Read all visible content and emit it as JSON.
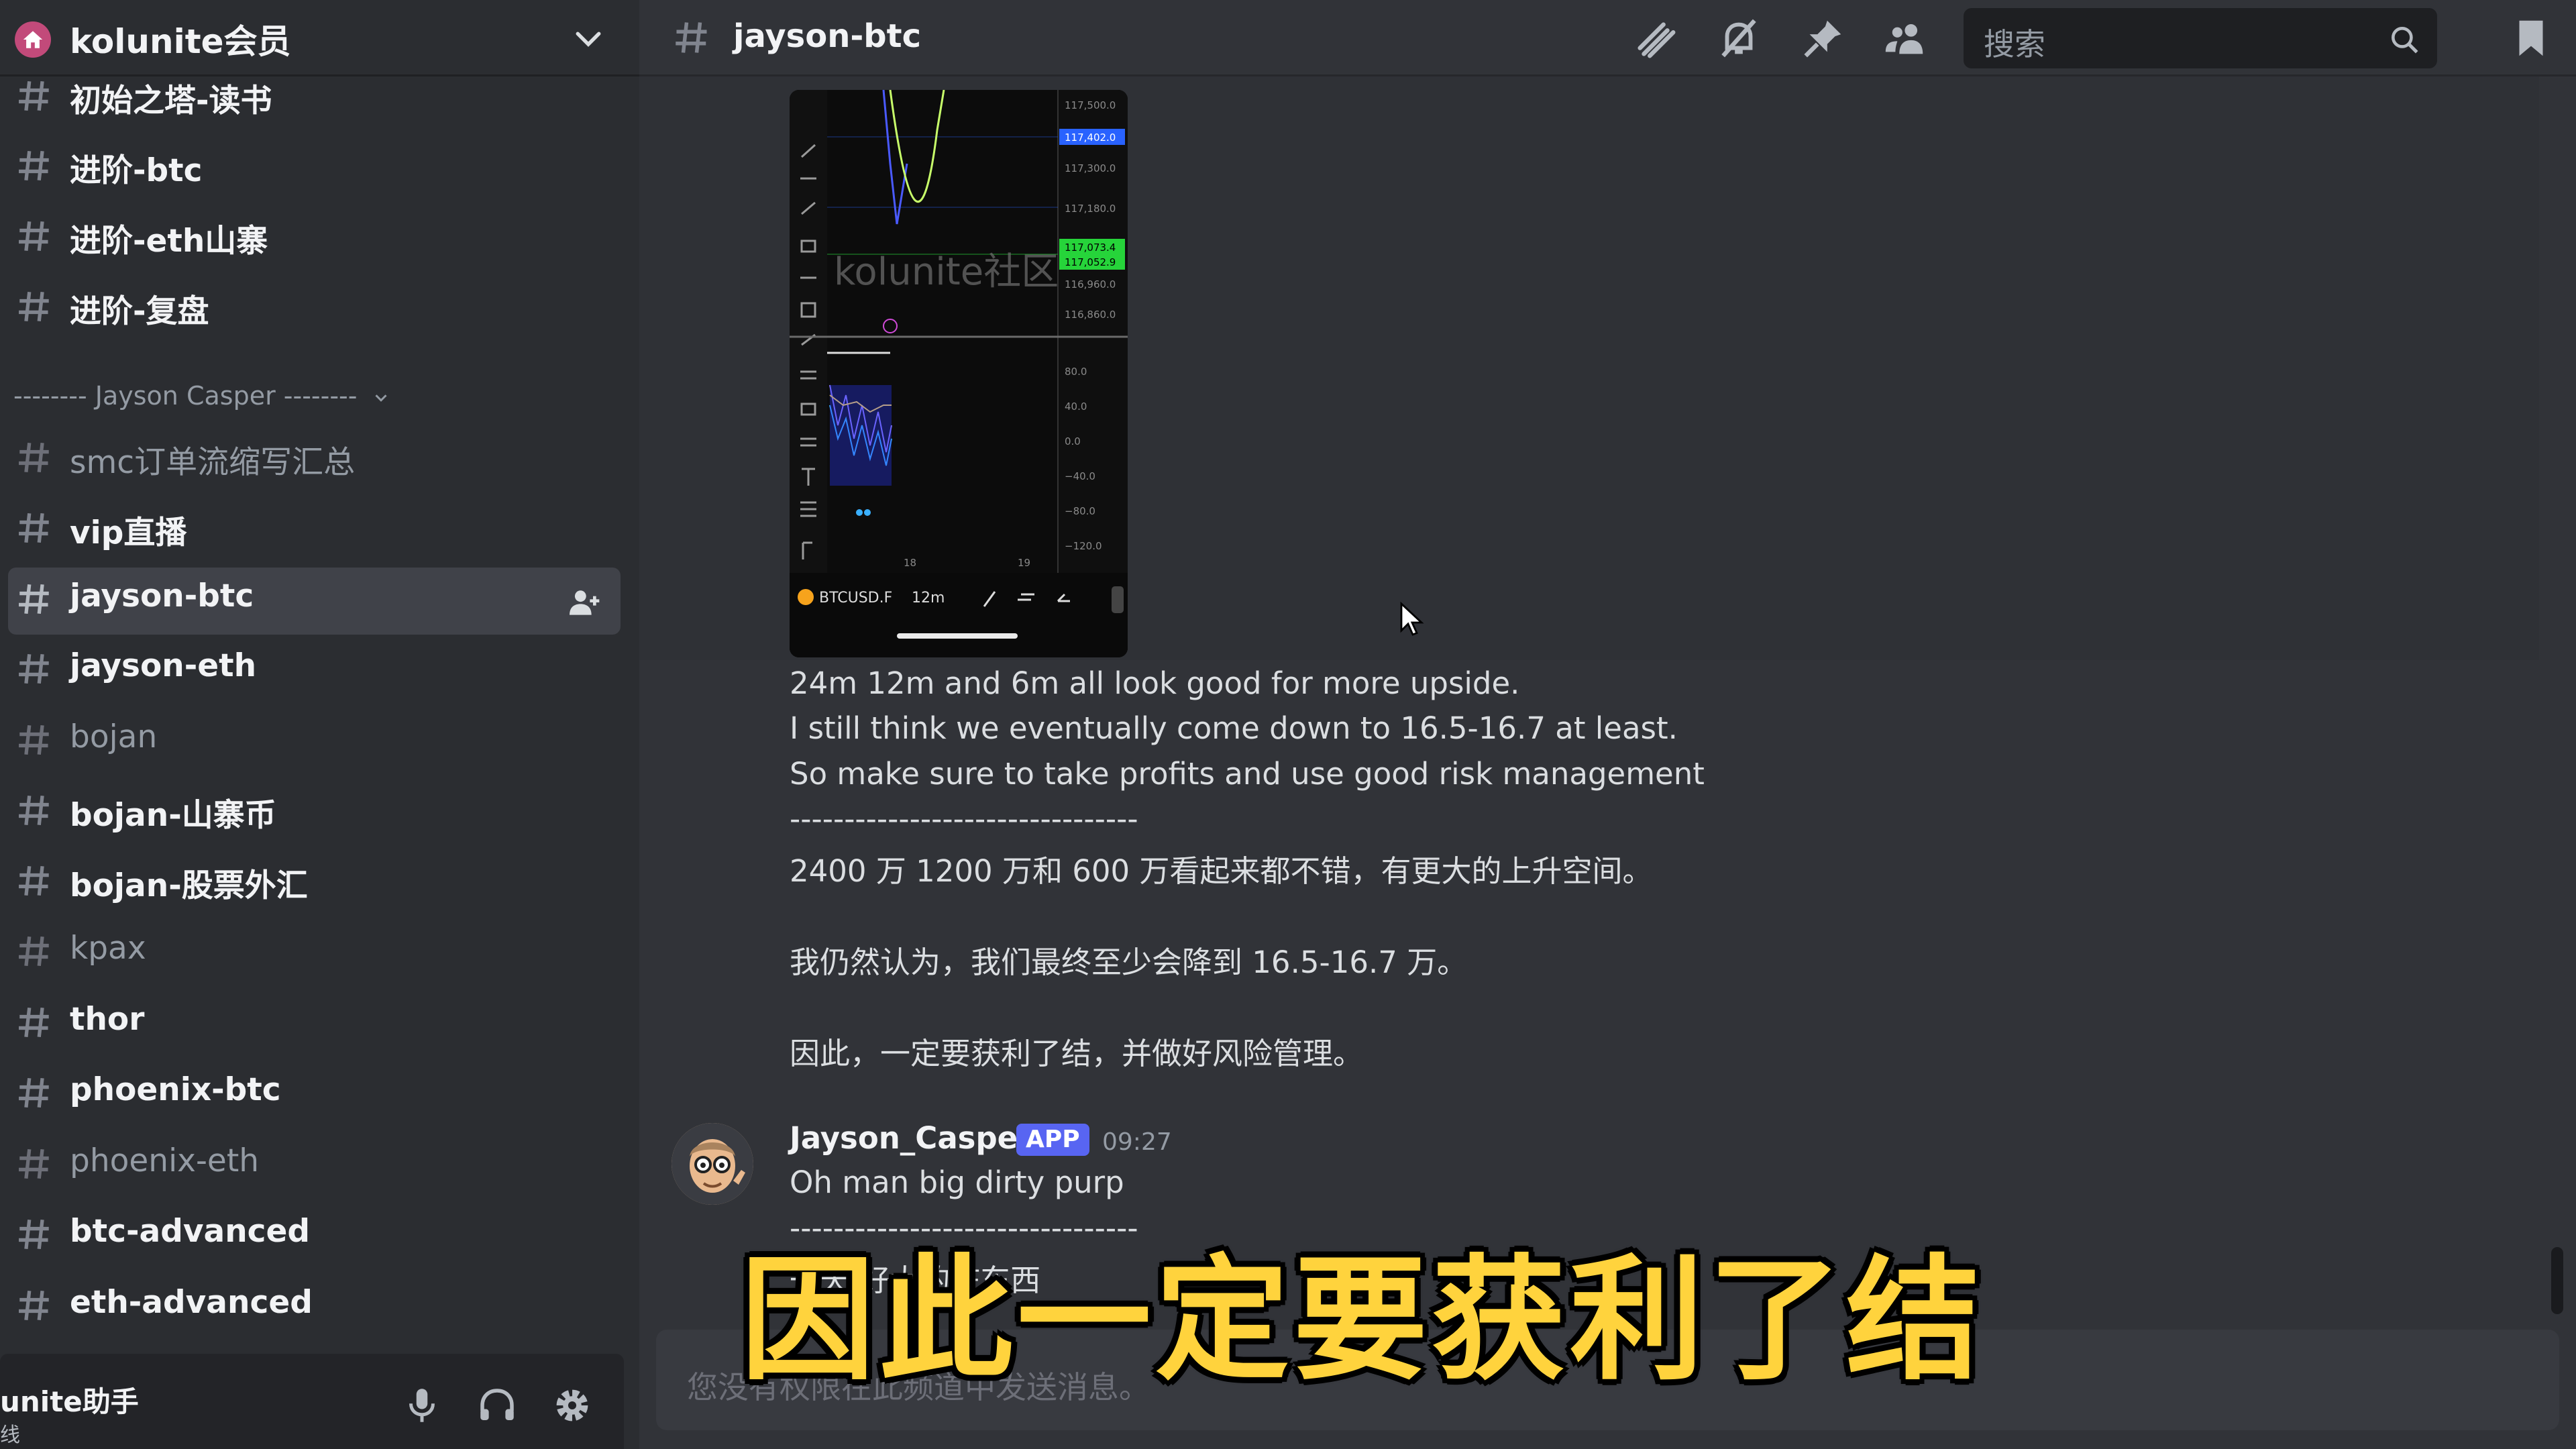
{
  "server": {
    "name": "kolunite会员"
  },
  "sidebar": {
    "channels_top": [
      {
        "name": "初始之塔-读书",
        "muted": false
      },
      {
        "name": "进阶-btc",
        "muted": false
      },
      {
        "name": "进阶-eth山寨",
        "muted": false
      },
      {
        "name": "进阶-复盘",
        "muted": false
      }
    ],
    "category": "-------- Jayson Casper --------",
    "channels": [
      {
        "name": "smc订单流缩写汇总",
        "muted": true
      },
      {
        "name": "vip直播",
        "muted": false
      },
      {
        "name": "jayson-btc",
        "muted": false,
        "active": true
      },
      {
        "name": "jayson-eth",
        "muted": false
      },
      {
        "name": "bojan",
        "muted": true
      },
      {
        "name": "bojan-山寨币",
        "muted": false
      },
      {
        "name": "bojan-股票外汇",
        "muted": false
      },
      {
        "name": "kpax",
        "muted": true
      },
      {
        "name": "thor",
        "muted": false
      },
      {
        "name": "phoenix-btc",
        "muted": false
      },
      {
        "name": "phoenix-eth",
        "muted": true
      },
      {
        "name": "btc-advanced",
        "muted": false
      },
      {
        "name": "eth-advanced",
        "muted": false
      }
    ]
  },
  "user_panel": {
    "name": "unite助手",
    "status": "线"
  },
  "header": {
    "channel_name": "jayson-btc",
    "search_placeholder": "搜索"
  },
  "chart_image": {
    "watermark": "kolunite社区",
    "symbol": "BTCUSD.F",
    "interval": "12m",
    "price_labels": [
      "117,500.0",
      "117,402.0",
      "117,300.0",
      "117,180.0",
      "117,073.4",
      "117,052.9",
      "116,960.0",
      "116,860.0"
    ],
    "indicator_labels": [
      "80.0",
      "40.0",
      "0.0",
      "−40.0",
      "−80.0",
      "−120.0"
    ],
    "time_labels": [
      "18",
      "19"
    ]
  },
  "messages": {
    "previous": [
      "24m 12m and 6m all look good for more upside.",
      "I still think we eventually come down to 16.5-16.7 at least.",
      "So make sure to take profits and use good risk management",
      "--------------------------------",
      "2400 万 1200 万和 600 万看起来都不错，有更大的上升空间。",
      "我仍然认为，我们最终至少会降到 16.5-16.7 万。",
      "因此，一定要获利了结，并做好风险管理。"
    ],
    "latest": {
      "author": "Jayson_Casper",
      "badge": "APP",
      "time": "09:27",
      "lines": [
        "Oh man big dirty purp",
        "--------------------------------",
        "一天    好大的脏东西"
      ]
    }
  },
  "input": {
    "placeholder": "您没有权限在此频道中发送消息。"
  },
  "subtitle": "因此一定要获利了结",
  "colors": {
    "accent": "#5865f2",
    "subtitle": "#ffd33d",
    "sidebar_bg": "#2b2d31",
    "chat_bg": "#313338"
  }
}
